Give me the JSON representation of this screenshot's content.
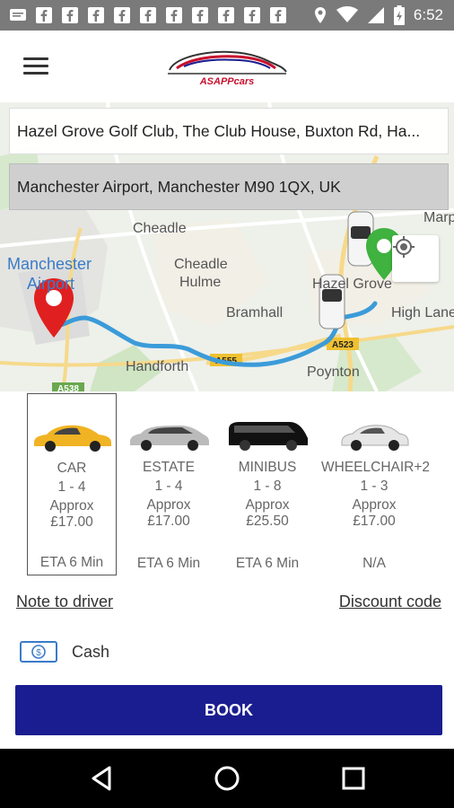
{
  "status_bar": {
    "time": "6:52",
    "left_icons": [
      "message-icon",
      "facebook-icon",
      "facebook-icon",
      "facebook-icon",
      "facebook-icon",
      "facebook-icon",
      "facebook-icon",
      "facebook-icon",
      "facebook-icon",
      "facebook-icon"
    ],
    "right_icons": [
      "location-icon",
      "wifi-icon",
      "signal-icon",
      "battery-icon"
    ]
  },
  "app_bar": {
    "logo_text": "ASAPPcars"
  },
  "map": {
    "pickup_address": "Hazel Grove Golf Club, The Club House, Buxton Rd, Ha...",
    "dropoff_address": "Manchester Airport, Manchester M90 1QX, UK",
    "labels": {
      "cheadle": "Cheadle",
      "manchester_airport_1": "Manchester",
      "manchester_airport_2": "Airport",
      "cheadle_hulme_1": "Cheadle",
      "cheadle_hulme_2": "Hulme",
      "bramhall": "Bramhall",
      "hazel_grove": "Hazel Grove",
      "high_lane": "High Lane",
      "handforth": "Handforth",
      "poynton": "Poynton",
      "marple": "Marp",
      "a555": "A555",
      "a523": "A523",
      "a538": "A538"
    },
    "colors": {
      "route": "#3b9bd9",
      "pickup_pin": "#e02020",
      "dropoff_pin": "#3fb23f"
    }
  },
  "vehicles": [
    {
      "name": "CAR",
      "seats": "1 - 4",
      "approx_label": "Approx",
      "price": "£17.00",
      "eta": "ETA 6 Min",
      "selected": true
    },
    {
      "name": "ESTATE",
      "seats": "1 - 4",
      "approx_label": "Approx",
      "price": "£17.00",
      "eta": "ETA 6 Min",
      "selected": false
    },
    {
      "name": "MINIBUS",
      "seats": "1 - 8",
      "approx_label": "Approx",
      "price": "£25.50",
      "eta": "ETA 6 Min",
      "selected": false
    },
    {
      "name": "WHEELCHAIR+2",
      "seats": "1 - 3",
      "approx_label": "Approx",
      "price": "£17.00",
      "eta": "N/A",
      "selected": false
    }
  ],
  "links": {
    "note_to_driver": "Note to driver",
    "discount_code": "Discount code"
  },
  "payment": {
    "method": "Cash"
  },
  "book_button": {
    "label": "BOOK",
    "color": "#1a1d8f"
  }
}
